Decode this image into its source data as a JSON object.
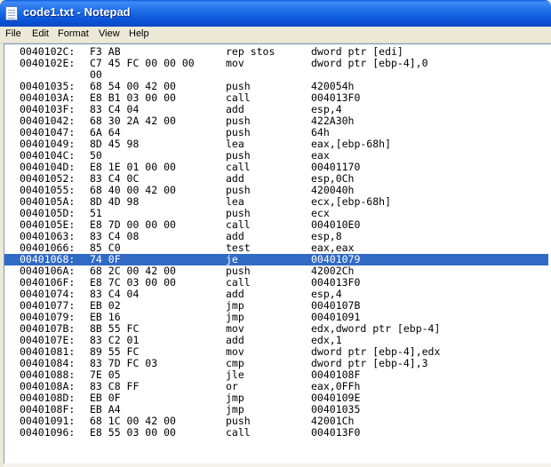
{
  "window": {
    "title": "code1.txt - Notepad",
    "icon": "notepad-icon"
  },
  "menu": [
    "File",
    "Edit",
    "Format",
    "View",
    "Help"
  ],
  "colors": {
    "selection": "#316AC5",
    "titlebar": "#0B55D8"
  },
  "selected_line": 19,
  "lines": [
    {
      "addr": "0040102C:",
      "bytes": "F3 AB",
      "mn": "rep stos",
      "op": "dword ptr [edi]"
    },
    {
      "addr": "0040102E:",
      "bytes": "C7 45 FC 00 00 00",
      "mn": "mov",
      "op": "dword ptr [ebp-4],0"
    },
    {
      "addr": "",
      "bytes": "00",
      "mn": "",
      "op": ""
    },
    {
      "addr": "00401035:",
      "bytes": "68 54 00 42 00",
      "mn": "push",
      "op": "420054h"
    },
    {
      "addr": "0040103A:",
      "bytes": "E8 B1 03 00 00",
      "mn": "call",
      "op": "004013F0"
    },
    {
      "addr": "0040103F:",
      "bytes": "83 C4 04",
      "mn": "add",
      "op": "esp,4"
    },
    {
      "addr": "00401042:",
      "bytes": "68 30 2A 42 00",
      "mn": "push",
      "op": "422A30h"
    },
    {
      "addr": "00401047:",
      "bytes": "6A 64",
      "mn": "push",
      "op": "64h"
    },
    {
      "addr": "00401049:",
      "bytes": "8D 45 98",
      "mn": "lea",
      "op": "eax,[ebp-68h]"
    },
    {
      "addr": "0040104C:",
      "bytes": "50",
      "mn": "push",
      "op": "eax"
    },
    {
      "addr": "0040104D:",
      "bytes": "E8 1E 01 00 00",
      "mn": "call",
      "op": "00401170"
    },
    {
      "addr": "00401052:",
      "bytes": "83 C4 0C",
      "mn": "add",
      "op": "esp,0Ch"
    },
    {
      "addr": "00401055:",
      "bytes": "68 40 00 42 00",
      "mn": "push",
      "op": "420040h"
    },
    {
      "addr": "0040105A:",
      "bytes": "8D 4D 98",
      "mn": "lea",
      "op": "ecx,[ebp-68h]"
    },
    {
      "addr": "0040105D:",
      "bytes": "51",
      "mn": "push",
      "op": "ecx"
    },
    {
      "addr": "0040105E:",
      "bytes": "E8 7D 00 00 00",
      "mn": "call",
      "op": "004010E0"
    },
    {
      "addr": "00401063:",
      "bytes": "83 C4 08",
      "mn": "add",
      "op": "esp,8"
    },
    {
      "addr": "00401066:",
      "bytes": "85 C0",
      "mn": "test",
      "op": "eax,eax"
    },
    {
      "addr": "00401068:",
      "bytes": "74 0F",
      "mn": "je",
      "op": "00401079"
    },
    {
      "addr": "0040106A:",
      "bytes": "68 2C 00 42 00",
      "mn": "push",
      "op": "42002Ch"
    },
    {
      "addr": "0040106F:",
      "bytes": "E8 7C 03 00 00",
      "mn": "call",
      "op": "004013F0"
    },
    {
      "addr": "00401074:",
      "bytes": "83 C4 04",
      "mn": "add",
      "op": "esp,4"
    },
    {
      "addr": "00401077:",
      "bytes": "EB 02",
      "mn": "jmp",
      "op": "0040107B"
    },
    {
      "addr": "00401079:",
      "bytes": "EB 16",
      "mn": "jmp",
      "op": "00401091"
    },
    {
      "addr": "0040107B:",
      "bytes": "8B 55 FC",
      "mn": "mov",
      "op": "edx,dword ptr [ebp-4]"
    },
    {
      "addr": "0040107E:",
      "bytes": "83 C2 01",
      "mn": "add",
      "op": "edx,1"
    },
    {
      "addr": "00401081:",
      "bytes": "89 55 FC",
      "mn": "mov",
      "op": "dword ptr [ebp-4],edx"
    },
    {
      "addr": "00401084:",
      "bytes": "83 7D FC 03",
      "mn": "cmp",
      "op": "dword ptr [ebp-4],3"
    },
    {
      "addr": "00401088:",
      "bytes": "7E 05",
      "mn": "jle",
      "op": "0040108F"
    },
    {
      "addr": "0040108A:",
      "bytes": "83 C8 FF",
      "mn": "or",
      "op": "eax,0FFh"
    },
    {
      "addr": "0040108D:",
      "bytes": "EB 0F",
      "mn": "jmp",
      "op": "0040109E"
    },
    {
      "addr": "0040108F:",
      "bytes": "EB A4",
      "mn": "jmp",
      "op": "00401035"
    },
    {
      "addr": "00401091:",
      "bytes": "68 1C 00 42 00",
      "mn": "push",
      "op": "42001Ch"
    },
    {
      "addr": "00401096:",
      "bytes": "E8 55 03 00 00",
      "mn": "call",
      "op": "004013F0"
    }
  ]
}
